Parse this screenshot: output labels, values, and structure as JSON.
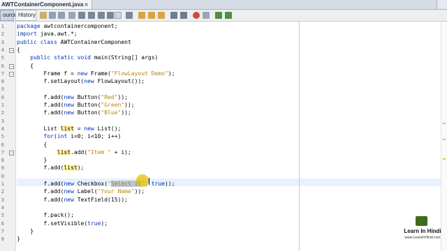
{
  "editor_tab": {
    "title": "AWTContainerComponent.java",
    "close": "×"
  },
  "toolbar": {
    "source_label": "ource",
    "history_label": "History"
  },
  "code_lines": [
    {
      "n": "1",
      "t": "package awtcontainercomponent;"
    },
    {
      "n": "2",
      "t": "import java.awt.*;"
    },
    {
      "n": "3",
      "t": "public class AWTContainerComponent"
    },
    {
      "n": "4",
      "t": "{"
    },
    {
      "n": "5",
      "t": "    public static void main(String[] args)"
    },
    {
      "n": "6",
      "t": "    {"
    },
    {
      "n": "7",
      "t": "        Frame f = new Frame(\"FlowLayout Demo\");"
    },
    {
      "n": "8",
      "t": "        f.setLayout(new FlowLayout());"
    },
    {
      "n": "9",
      "t": ""
    },
    {
      "n": "0",
      "t": "        f.add(new Button(\"Red\"));"
    },
    {
      "n": "1",
      "t": "        f.add(new Button(\"Green\"));"
    },
    {
      "n": "2",
      "t": "        f.add(new Button(\"Blue\"));"
    },
    {
      "n": "3",
      "t": ""
    },
    {
      "n": "4",
      "t": "        List list = new List();"
    },
    {
      "n": "5",
      "t": "        for(int i=0; i<10; i++)"
    },
    {
      "n": "6",
      "t": "        {"
    },
    {
      "n": "7",
      "t": "            list.add(\"Item \" + i);"
    },
    {
      "n": "8",
      "t": "        }"
    },
    {
      "n": "9",
      "t": "        f.add(list);"
    },
    {
      "n": "0",
      "t": ""
    },
    {
      "n": "1",
      "t": "        f.add(new Checkbox(\"Select it\", true));"
    },
    {
      "n": "2",
      "t": "        f.add(new Label(\"Your Name\"));"
    },
    {
      "n": "3",
      "t": "        f.add(new TextField(15));"
    },
    {
      "n": "4",
      "t": ""
    },
    {
      "n": "5",
      "t": "        f.pack();"
    },
    {
      "n": "6",
      "t": "        f.setVisible(true);"
    },
    {
      "n": "7",
      "t": "    }"
    },
    {
      "n": "8",
      "t": "}"
    }
  ],
  "logo": {
    "title": "Learn In Hindi",
    "url": "www.LearnInHindi.com"
  },
  "colors": {
    "keyword": "#0033b3",
    "string": "#b8860b",
    "occurrence": "#fff3a8",
    "margin": "#f3b7b7"
  }
}
